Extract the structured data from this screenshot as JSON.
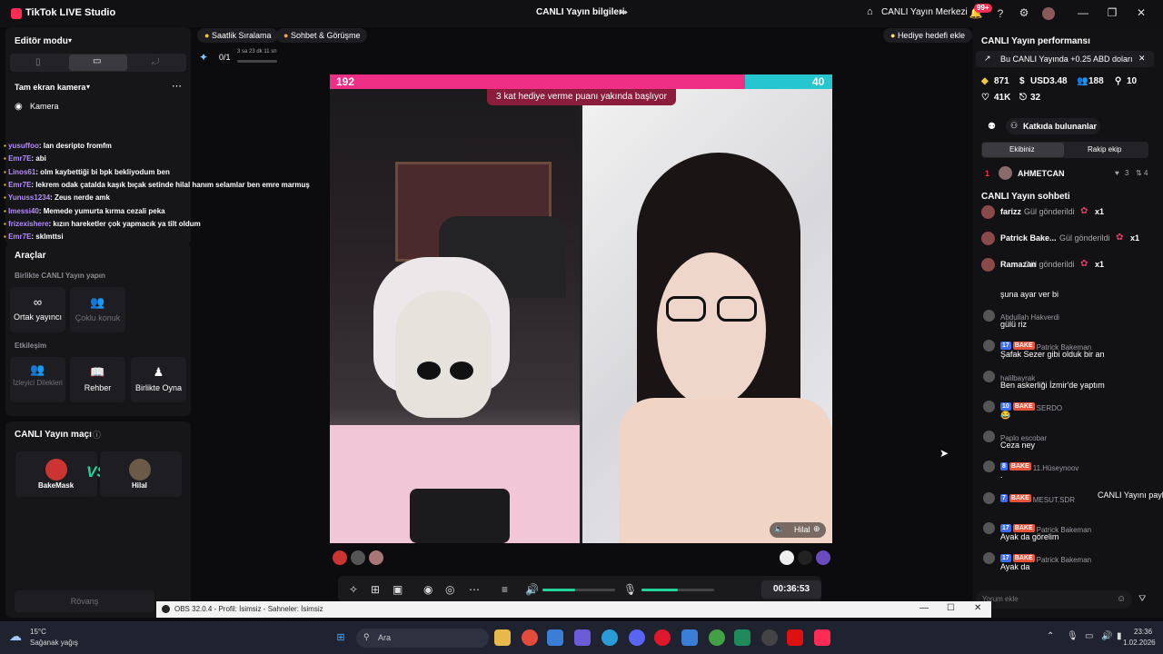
{
  "titlebar": {
    "app_title": "TikTok LIVE Studio",
    "center_title": "CANLI Yayın bilgileri",
    "live_center": "CANLI Yayın Merkezi",
    "notif_count": "99+"
  },
  "left": {
    "editor_mode": "Editör modu",
    "fullscreen_camera": "Tam ekran kamera",
    "camera": "Kamera"
  },
  "overlay_chat": [
    {
      "name": "yusuffoo",
      "text": ": lan desripto fromfm"
    },
    {
      "name": "Emr7E",
      "text": ": abi"
    },
    {
      "name": "Linos61",
      "text": ": olm kaybettiği bi bpk bekliyodum ben"
    },
    {
      "name": "Emr7E",
      "text": ": lekrem odak çatalda kaşık bıçak setinde hilal hanım selamlar ben emre marmuş"
    },
    {
      "name": "Yunuss1234",
      "text": ": Zeus nerde amk"
    },
    {
      "name": "lmessi40",
      "text": ": Memede yumurta kırma cezali peka"
    },
    {
      "name": "frizexishere",
      "text": ": kızın hareketler çok yapmacık ya tilt oldum"
    },
    {
      "name": "Emr7E",
      "text": ": sklmttsi"
    }
  ],
  "tools": {
    "title": "Araçlar",
    "together": "Birlikte CANLI Yayın yapın",
    "co_host": "Ortak yayıncı",
    "multi_guest": "Çoklu konuk",
    "interaction": "Etkileşim",
    "viewer_wishes": "İzleyici Dilekleri",
    "guide": "Rehber",
    "play_together": "Birlikte Oyna"
  },
  "match": {
    "title": "CANLI Yayın maçı",
    "p1": "BakeMask",
    "p2": "Hilal",
    "rematch": "Rövanş"
  },
  "top": {
    "hourly": "Saatlik Sıralama",
    "chat_meet": "Sohbet & Görüşme",
    "gift_goal": "Hediye hedefi ekle",
    "progress": "0/1",
    "progress_time": "3 sa 23 dk 11 sn"
  },
  "battle": {
    "score_left": "192",
    "score_right": "40",
    "banner": "3 kat hediye verme puanı yakında başlıyor",
    "opponent": "Hilal",
    "left_fill": 0.827
  },
  "controls": {
    "timer": "00:36:53",
    "volume": 0.45,
    "mic": 0.5
  },
  "right": {
    "perf_title": "CANLI Yayın performansı",
    "promo": "Bu CANLI Yayında +0.25 ABD doları",
    "coins": "871",
    "usd": "USD3.48",
    "viewers": "188",
    "followers": "10",
    "likes": "41K",
    "shares": "32",
    "contributors": "Katkıda bulunanlar",
    "tab_mine": "Ekibiniz",
    "tab_rival": "Rakip ekip",
    "rank1": "1",
    "rank1_name": "AHMETCAN",
    "rank1_a": "3",
    "rank1_b": "4",
    "chat_title": "CANLI Yayın sohbeti",
    "comment_placeholder": "Yorum ekle"
  },
  "gifts": [
    {
      "name": "farizz",
      "text": "Gül gönderildi",
      "count": "x1"
    },
    {
      "name": "Patrick Bake...",
      "text": "Gül gönderildi",
      "count": "x1"
    },
    {
      "name": "Ramazan",
      "text": "Gül gönderildi",
      "count": "x1"
    }
  ],
  "rchat": [
    {
      "name": "",
      "msg": "şuna ayar ver bi",
      "lv": "",
      "bk": ""
    },
    {
      "name": "Abdullah Hakverdi",
      "msg": "gülü riz",
      "lv": "",
      "bk": ""
    },
    {
      "name": "Patrick Bakeman",
      "msg": "Şafak Sezer gibi olduk bir an",
      "lv": "17",
      "bk": "BAKE"
    },
    {
      "name": "halilbayrak",
      "msg": "Ben askerliği İzmir'de yaptım",
      "lv": "",
      "bk": ""
    },
    {
      "name": "SERDO",
      "msg": "😂",
      "lv": "10",
      "bk": "BAKE"
    },
    {
      "name": "Paplo escobar",
      "msg": "Ceza ney",
      "lv": "",
      "bk": ""
    },
    {
      "name": "11.Hüseynoov",
      "msg": ".",
      "lv": "8",
      "bk": "BAKE"
    },
    {
      "name": "MESUT.SDR",
      "msg": "CANLI Yayını paylaştı",
      "lv": "7",
      "bk": "BAKE"
    },
    {
      "name": "Patrick Bakeman",
      "msg": "Ayak da görelim",
      "lv": "17",
      "bk": "BAKE"
    },
    {
      "name": "Patrick Bakeman",
      "msg": "Ayak da",
      "lv": "17",
      "bk": "BAKE"
    }
  ],
  "obs": {
    "title": "OBS 32.0.4 - Profil: İsimsiz - Sahneler: İsimsiz"
  },
  "taskbar": {
    "temp": "15°C",
    "weather": "Sağanak yağış",
    "search": "Ara",
    "time": "23:36",
    "date": "1.02.2026"
  },
  "colors": {
    "accent": "#fe2c55",
    "left_bar": "#ef2e86",
    "right_bar": "#25c6cf",
    "green": "#22d39a"
  }
}
